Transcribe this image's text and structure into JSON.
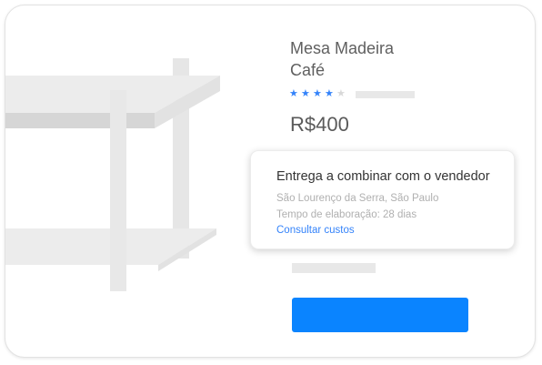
{
  "product": {
    "title_line1": "Mesa Madeira",
    "title_line2": "Café",
    "rating": {
      "filled_stars": 4,
      "total_stars": 5,
      "star_color": "#3483fa"
    },
    "price": "R$400"
  },
  "shipping_popup": {
    "title": "Entrega a combinar com o vendedor",
    "location": "São Lourenço da Serra, São Paulo",
    "preparation_time": "Tempo de elaboração: 28 dias",
    "link_label": "Consultar custos",
    "link_color": "#3483fa"
  },
  "buy_button": {
    "color": "#0a84ff"
  }
}
